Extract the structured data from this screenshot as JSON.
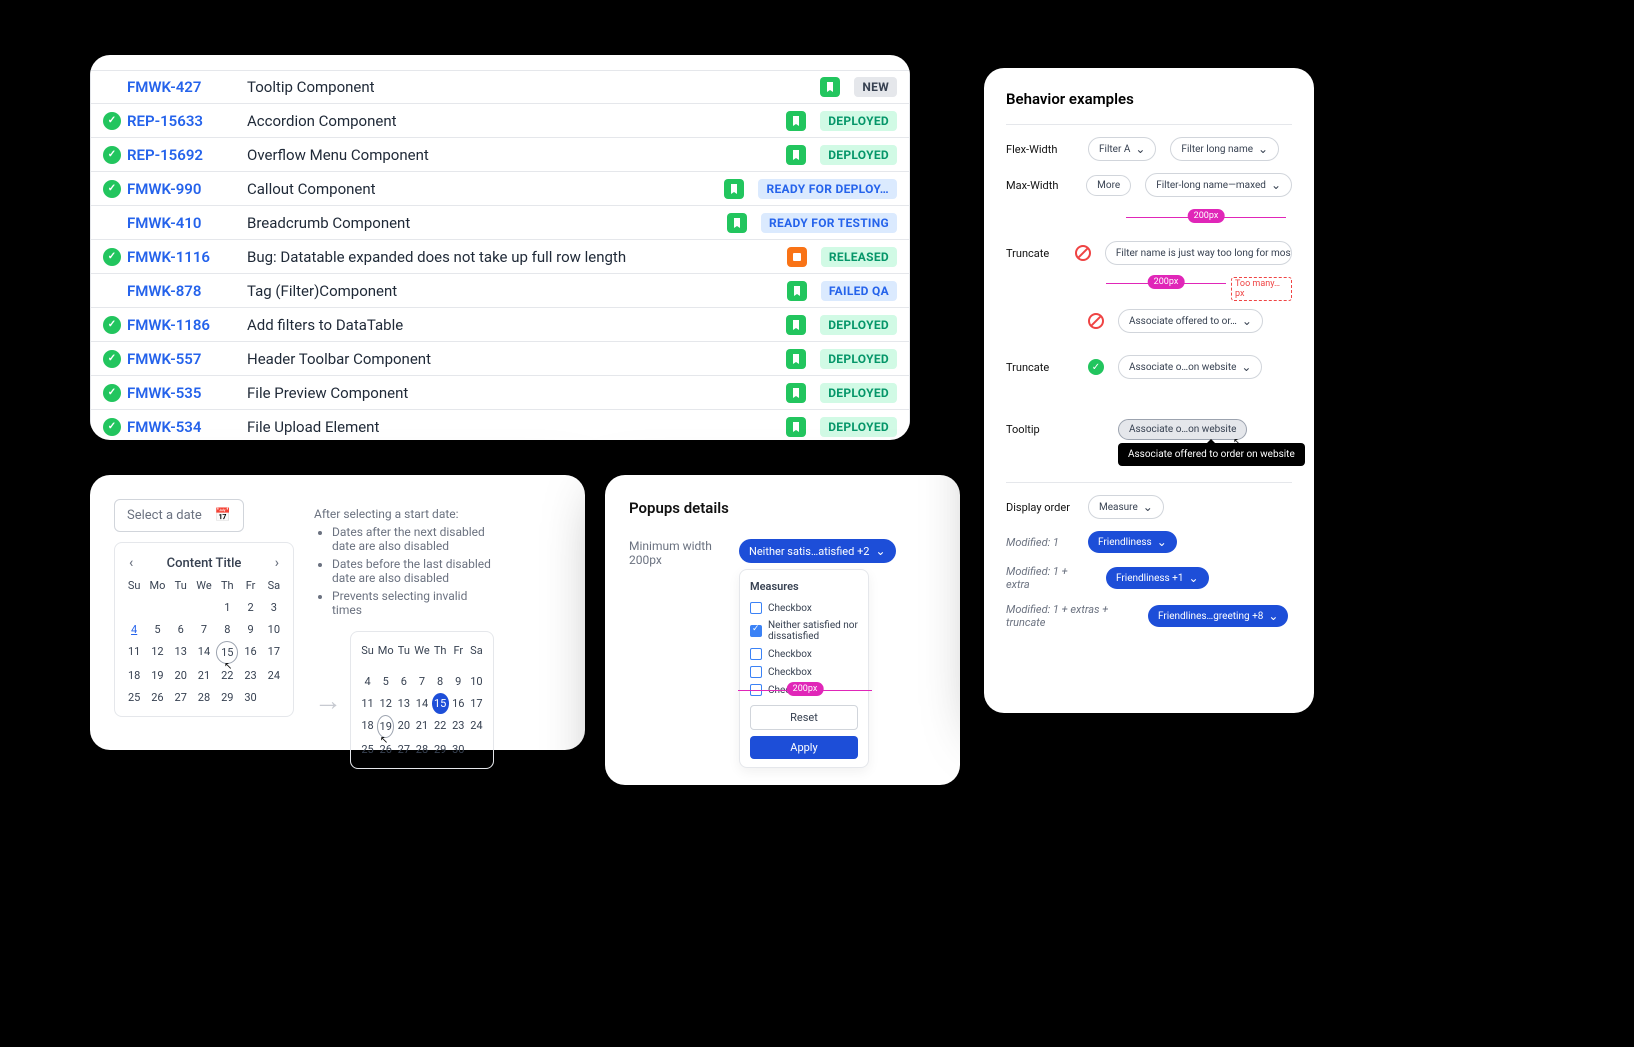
{
  "tickets": [
    {
      "check": false,
      "id": "FMWK-427",
      "title": "Tooltip Component",
      "icon": "g",
      "status": "NEW",
      "cls": "st-new"
    },
    {
      "check": true,
      "id": "REP-15633",
      "title": "Accordion Component",
      "icon": "g",
      "status": "DEPLOYED",
      "cls": "st-dep"
    },
    {
      "check": true,
      "id": "REP-15692",
      "title": "Overflow Menu Component",
      "icon": "g",
      "status": "DEPLOYED",
      "cls": "st-dep"
    },
    {
      "check": true,
      "id": "FMWK-990",
      "title": "Callout Component",
      "icon": "g",
      "status": "READY FOR DEPLOY…",
      "cls": "st-rdy"
    },
    {
      "check": false,
      "id": "FMWK-410",
      "title": "Breadcrumb Component",
      "icon": "g",
      "status": "READY FOR TESTING",
      "cls": "st-rdy"
    },
    {
      "check": true,
      "id": "FMWK-1116",
      "title": "Bug: Datatable expanded does not take up full row length",
      "icon": "o",
      "status": "RELEASED",
      "cls": "st-rel"
    },
    {
      "check": false,
      "id": "FMWK-878",
      "title": "Tag (Filter)Component",
      "icon": "g",
      "status": "FAILED QA",
      "cls": "st-fqa"
    },
    {
      "check": true,
      "id": "FMWK-1186",
      "title": "Add filters to DataTable",
      "icon": "g",
      "status": "DEPLOYED",
      "cls": "st-dep"
    },
    {
      "check": true,
      "id": "FMWK-557",
      "title": "Header Toolbar Component",
      "icon": "g",
      "status": "DEPLOYED",
      "cls": "st-dep"
    },
    {
      "check": true,
      "id": "FMWK-535",
      "title": "File Preview Component",
      "icon": "g",
      "status": "DEPLOYED",
      "cls": "st-dep"
    },
    {
      "check": true,
      "id": "FMWK-534",
      "title": "File Upload Element",
      "icon": "g",
      "status": "DEPLOYED",
      "cls": "st-dep"
    }
  ],
  "datepicker": {
    "placeholder": "Select a date",
    "title": "Content Title",
    "dow": [
      "Su",
      "Mo",
      "Tu",
      "We",
      "Th",
      "Fr",
      "Sa"
    ],
    "notes_title": "After selecting a start date:",
    "notes": [
      "Dates after the next disabled date are also disabled",
      "Dates before the last disabled date are also disabled",
      "Prevents selecting invalid times"
    ]
  },
  "popup": {
    "heading": "Popups details",
    "label": "Minimum width 200px",
    "pill": "Neither satis…atisfied +2",
    "measures": "Measures",
    "items": [
      {
        "t": "Checkbox",
        "c": false
      },
      {
        "t": "Neither satisfied nor dissatisfied",
        "c": true
      },
      {
        "t": "Checkbox",
        "c": false
      },
      {
        "t": "Checkbox",
        "c": false
      },
      {
        "t": "Checkbox",
        "c": false
      }
    ],
    "reset": "Reset",
    "apply": "Apply",
    "ruler": "200px"
  },
  "behavior": {
    "heading": "Behavior examples",
    "flex": {
      "label": "Flex-Width",
      "a": "Filter A",
      "b": "Filter long name"
    },
    "max": {
      "label": "Max-Width",
      "a": "More",
      "b": "Filter-long name—maxed",
      "ruler": "200px"
    },
    "trunc_bad": {
      "label": "Truncate",
      "chip": "Filter name is just way too long for most UI",
      "ruler": "200px",
      "err": "Too many…px"
    },
    "trunc_assoc": "Associate offered to or…",
    "trunc_ok": {
      "label": "Truncate",
      "chip": "Associate o…on website"
    },
    "tooltip": {
      "label": "Tooltip",
      "chip": "Associate o…on website",
      "tip": "Associate offered to order on website"
    },
    "disp": {
      "label": "Display order",
      "chip": "Measure"
    },
    "mod1": {
      "label": "Modified: 1",
      "chip": "Friendliness"
    },
    "mod2": {
      "label": "Modified: 1 + extra",
      "chip": "Friendliness +1"
    },
    "mod3": {
      "label": "Modified: 1 + extras + truncate",
      "chip": "Friendlines…greeting +8"
    }
  }
}
